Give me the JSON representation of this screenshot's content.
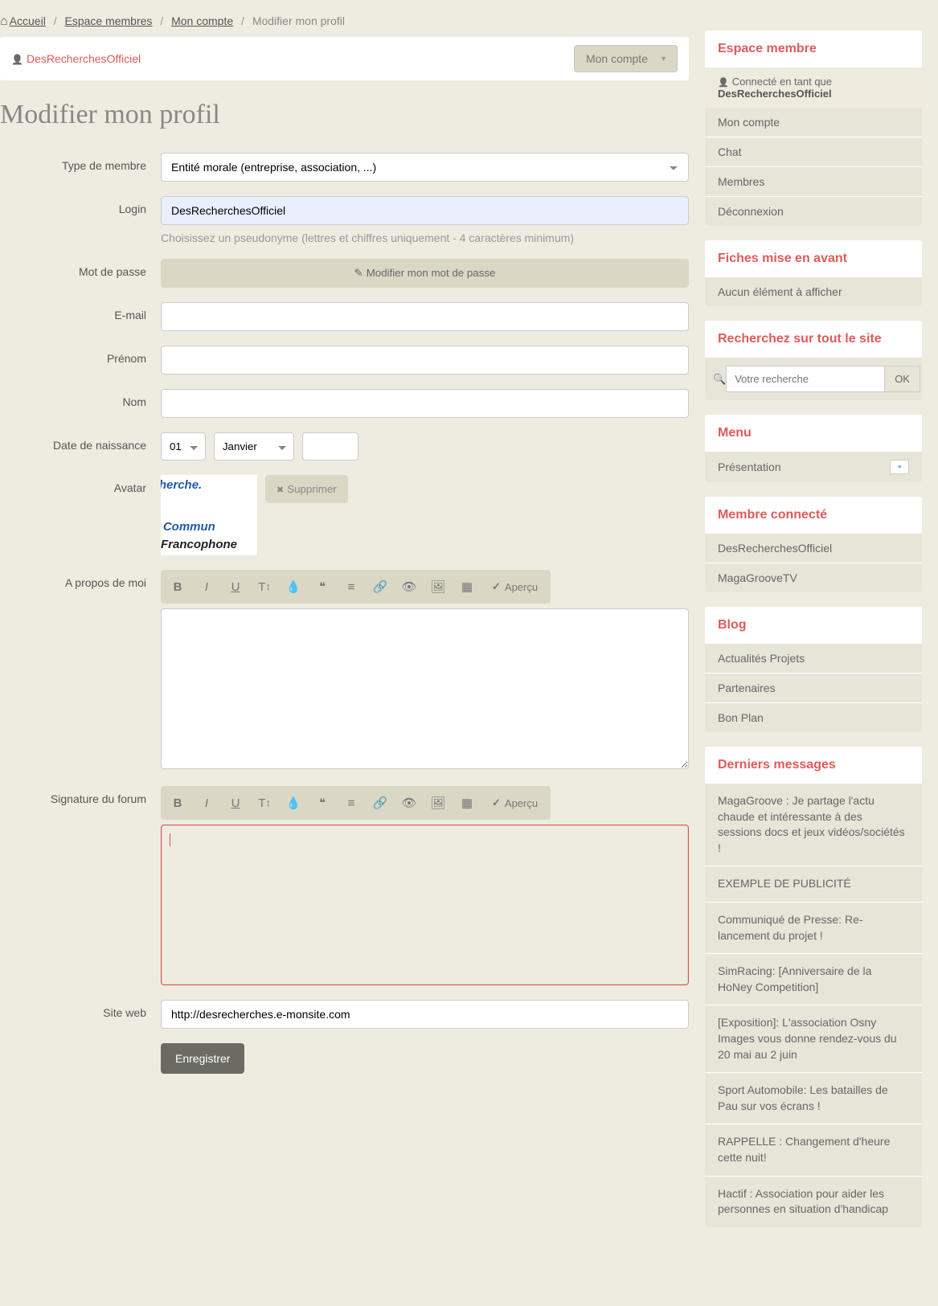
{
  "breadcrumb": {
    "home": "Accueil",
    "members": "Espace membres",
    "account": "Mon compte",
    "current": "Modifier mon profil"
  },
  "userbar": {
    "username": "DesRecherchesOfficiel",
    "dropdown": "Mon compte"
  },
  "page_title": "Modifier mon profil",
  "form": {
    "member_type_label": "Type de membre",
    "member_type_value": "Entité morale (entreprise, association, ...)",
    "login_label": "Login",
    "login_value": "DesRecherchesOfficiel",
    "login_help": "Choisissez un pseudonyme (lettres et chiffres uniquement - 4 caractères minimum)",
    "password_label": "Mot de passe",
    "password_btn": "Modifier mon mot de passe",
    "email_label": "E-mail",
    "firstname_label": "Prénom",
    "lastname_label": "Nom",
    "birthdate_label": "Date de naissance",
    "birth_day": "01",
    "birth_month": "Janvier",
    "avatar_label": "Avatar",
    "delete_btn": "Supprimer",
    "avatar_t1": "sRecherche.",
    "avatar_t2": "ail Commun",
    "avatar_t3": "Francophone",
    "about_label": "A propos de moi",
    "signature_label": "Signature du forum",
    "preview_label": "Aperçu",
    "website_label": "Site web",
    "website_value": "http://desrecherches.e-monsite.com",
    "submit": "Enregistrer"
  },
  "sidebar": {
    "espace_title": "Espace membre",
    "connected_as": "Connecté en tant que",
    "connected_name": "DesRecherchesOfficiel",
    "espace_items": [
      "Mon compte",
      "Chat",
      "Membres",
      "Déconnexion"
    ],
    "fiches_title": "Fiches mise en avant",
    "fiches_empty": "Aucun élément à afficher",
    "search_title": "Recherchez sur tout le site",
    "search_placeholder": "Votre recherche",
    "search_btn": "OK",
    "menu_title": "Menu",
    "menu_item": "Présentation",
    "connected_title": "Membre connecté",
    "connected_list": [
      "DesRecherchesOfficiel",
      "MagaGrooveTV"
    ],
    "blog_title": "Blog",
    "blog_items": [
      "Actualités Projets",
      "Partenaires",
      "Bon Plan"
    ],
    "messages_title": "Derniers messages",
    "messages": [
      "MagaGroove : Je partage l'actu chaude et intéressante à des sessions docs et jeux vidéos/sociétés !",
      "EXEMPLE DE PUBLICITÉ",
      "Communiqué de Presse: Re-lancement du projet !",
      "SimRacing: [Anniversaire de la HoNey Competition]",
      "[Exposition]: L'association Osny Images vous donne rendez-vous du 20 mai au 2 juin",
      "Sport Automobile: Les batailles de Pau sur vos écrans !",
      "RAPPELLE : Changement d'heure cette nuit!",
      "Hactif : Association pour aider les personnes en situation d'handicap"
    ]
  }
}
